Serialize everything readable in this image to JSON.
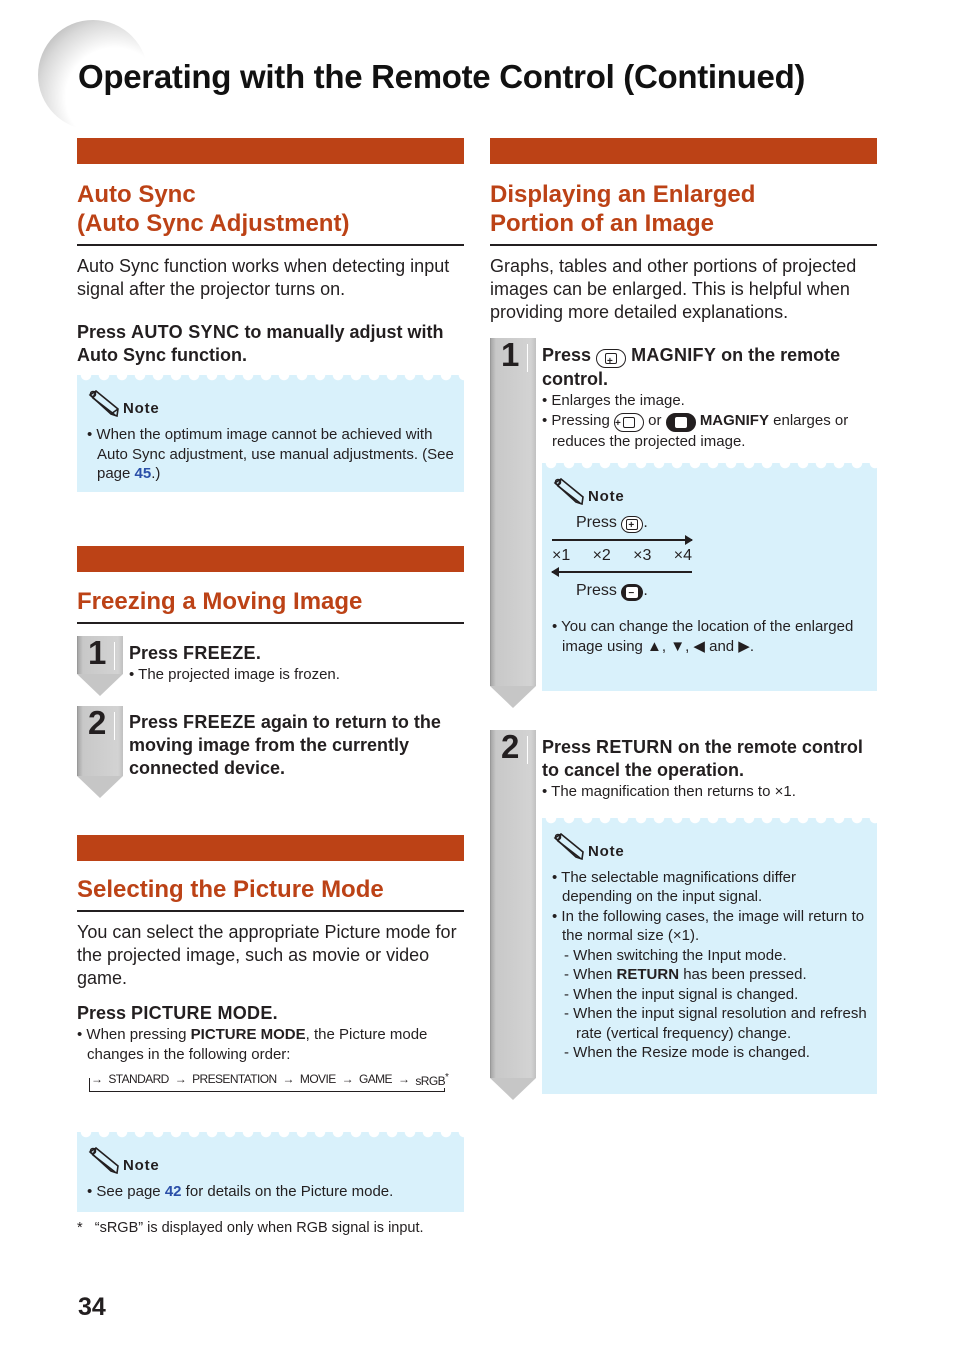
{
  "page": {
    "title": "Operating with the Remote Control (Continued)",
    "page_number": "34"
  },
  "auto_sync": {
    "heading_line1": "Auto Sync",
    "heading_line2": "(Auto Sync Adjustment)",
    "intro": "Auto Sync function works when detecting input signal after the projector turns on.",
    "press_prefix": "Press ",
    "press_key": "AUTO SYNC",
    "press_suffix": " to manually adjust with Auto Sync function.",
    "note_title": "Note",
    "note_text_before": "When the optimum image cannot be achieved with Auto Sync adjustment, use manual adjustments. (See page ",
    "note_link": "45",
    "note_text_after": ".)"
  },
  "freeze": {
    "heading": "Freezing a Moving Image",
    "steps": [
      {
        "num": "1",
        "prefix": "Press ",
        "key": "FREEZE",
        "suffix": ".",
        "sub": "The projected image is frozen."
      },
      {
        "num": "2",
        "prefix": "Press ",
        "key": "FREEZE",
        "suffix": " again to return to the moving image from the currently connected device."
      }
    ]
  },
  "picture_mode": {
    "heading": "Selecting the Picture Mode",
    "intro": "You can select the appropriate Picture mode for the projected image, such as movie or video game.",
    "press_prefix": "Press ",
    "press_key": "PICTURE MODE",
    "press_suffix": ".",
    "bullet_before": "When pressing ",
    "bullet_key": "PICTURE MODE",
    "bullet_after": ", the Picture mode changes in the following order:",
    "modes": [
      "STANDARD",
      "PRESENTATION",
      "MOVIE",
      "GAME",
      "sRGB"
    ],
    "asterisk": "*",
    "note_title": "Note",
    "note_before": "See page ",
    "note_link": "42",
    "note_after": " for details on the Picture mode.",
    "footnote_mark": "*",
    "footnote": "“sRGB” is displayed only when RGB signal is input."
  },
  "magnify": {
    "heading_line1": "Displaying an Enlarged",
    "heading_line2": "Portion of an Image",
    "intro": "Graphs, tables and other portions of projected images can be enlarged. This is helpful when providing more detailed explanations.",
    "step1": {
      "num": "1",
      "prefix": "Press ",
      "key": "MAGNIFY",
      "suffix": " on the remote control.",
      "sub1": "Enlarges the image.",
      "sub2_before": "Pressing ",
      "sub2_or": " or ",
      "sub2_key": "MAGNIFY",
      "sub2_after": " enlarges or reduces the projected image.",
      "note_title": "Note",
      "press_label": "Press",
      "scales": [
        "×1",
        "×2",
        "×3",
        "×4"
      ],
      "location_note": "You can change the location of the enlarged image using ▲, ▼, ◀ and ▶."
    },
    "step2": {
      "num": "2",
      "prefix": "Press ",
      "key": "RETURN",
      "suffix": " on the remote control to cancel the operation.",
      "sub": "The magnification then returns to ×1.",
      "note_title": "Note",
      "note_bullet1": "The selectable magnifications differ depending on the input signal.",
      "note_bullet2": "In the following cases, the image will return to the normal size (×1).",
      "cases": [
        {
          "before": "When switching the Input mode.",
          "key": "",
          "after": ""
        },
        {
          "before": "When ",
          "key": "RETURN",
          "after": " has been pressed."
        },
        {
          "before": "When the input signal is changed.",
          "key": "",
          "after": ""
        },
        {
          "before": "When the input signal resolution and refresh rate (vertical frequency) change.",
          "key": "",
          "after": ""
        },
        {
          "before": "When the Resize mode is changed.",
          "key": "",
          "after": ""
        }
      ]
    }
  }
}
